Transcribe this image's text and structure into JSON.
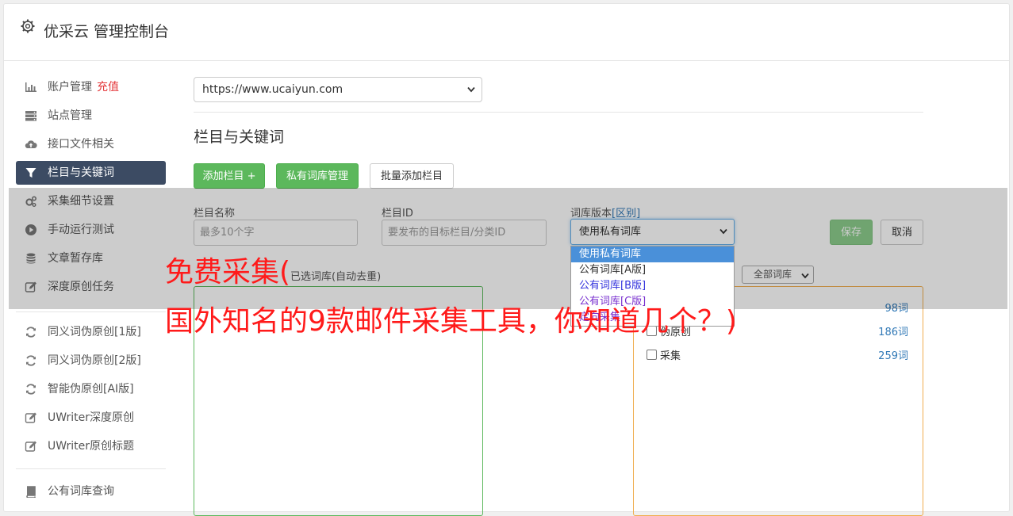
{
  "header": {
    "title": "优采云 管理控制台",
    "icon": "gear-icon"
  },
  "sidebar": {
    "items": [
      {
        "label": "账户管理",
        "extra": "充值",
        "icon": "bar-chart-icon"
      },
      {
        "label": "站点管理",
        "icon": "server-icon"
      },
      {
        "label": "接口文件相关",
        "icon": "cloud-upload-icon"
      },
      {
        "label": "栏目与关键词",
        "icon": "filter-icon",
        "active": true
      },
      {
        "label": "采集细节设置",
        "icon": "cogs-icon"
      },
      {
        "label": "手动运行测试",
        "icon": "play-circle-icon"
      },
      {
        "label": "文章暂存库",
        "icon": "database-icon"
      },
      {
        "label": "深度原创任务",
        "icon": "edit-icon"
      },
      {
        "label": "同义词伪原创[1版]",
        "icon": "refresh-icon"
      },
      {
        "label": "同义词伪原创[2版]",
        "icon": "refresh-icon"
      },
      {
        "label": "智能伪原创[AI版]",
        "icon": "refresh-icon"
      },
      {
        "label": "UWriter深度原创",
        "icon": "edit-icon"
      },
      {
        "label": "UWriter原创标题",
        "icon": "edit-icon"
      },
      {
        "label": "公有词库查询",
        "icon": "book-icon"
      }
    ]
  },
  "site_select": {
    "value": "https://www.ucaiyun.com"
  },
  "section": {
    "title": "栏目与关键词"
  },
  "toolbar": {
    "add_column": "添加栏目 +",
    "private_lib": "私有词库管理",
    "batch_add": "批量添加栏目"
  },
  "form": {
    "name_label": "栏目名称",
    "name_placeholder": "最多10个字",
    "id_label": "栏目ID",
    "id_placeholder": "要发布的目标栏目/分类ID",
    "lib_label": "词库版本",
    "lib_label_link": "[区别]",
    "lib_selected": "使用私有词库",
    "lib_options": [
      "使用私有词库",
      "公有词库[A版]",
      "公有词库[B版]",
      "公有词库[C版]",
      "定向采集"
    ],
    "save": "保存",
    "cancel": "取消"
  },
  "selected_box": {
    "label": "已选词库(自动去重)"
  },
  "library": {
    "filter": "全部词库",
    "rows": [
      {
        "name": "",
        "count": "98词"
      },
      {
        "name": "伪原创",
        "count": "186词"
      },
      {
        "name": "采集",
        "count": "259词"
      }
    ]
  },
  "overlay_text": {
    "line1": "免费采集(",
    "line2": "国外知名的9款邮件采集工具，你知道几个？)"
  },
  "colors": {
    "accent_dark": "#3c4b63",
    "green": "#5cb85c",
    "orange": "#f0ad4e",
    "red": "#ff1a1a"
  }
}
